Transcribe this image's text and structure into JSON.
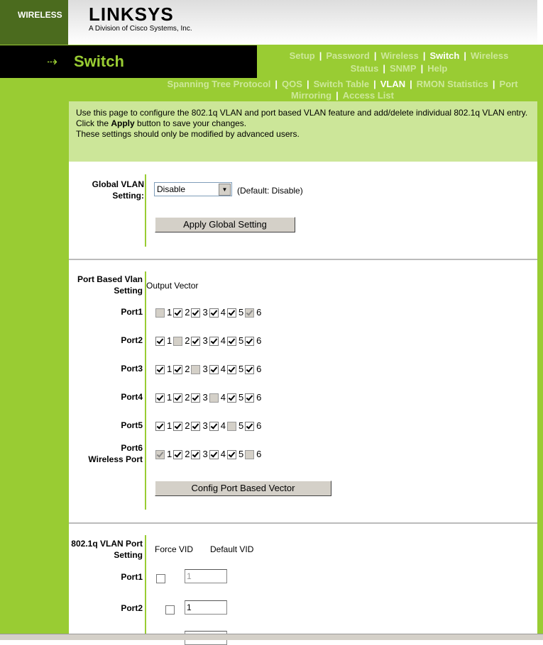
{
  "header": {
    "brand": "WIRELESS",
    "logo": "LINKSYS",
    "logo_sub": "A Division of Cisco Systems, Inc.",
    "section": "Switch",
    "accent": "#99cc33"
  },
  "nav_main": [
    {
      "label": "Setup"
    },
    {
      "label": "Password"
    },
    {
      "label": "Wireless"
    },
    {
      "label": "Switch",
      "selected": true
    },
    {
      "label": "Wireless Status"
    },
    {
      "label": "SNMP"
    },
    {
      "label": "Help"
    }
  ],
  "nav_sub": [
    {
      "label": "Spanning Tree Protocol"
    },
    {
      "label": "QOS"
    },
    {
      "label": "Switch Table"
    },
    {
      "label": "VLAN",
      "selected": true
    },
    {
      "label": "RMON Statistics"
    },
    {
      "label": "Port Mirroring"
    },
    {
      "label": "Access List"
    }
  ],
  "info": {
    "line1": "Use this page to configure the 802.1q VLAN and port based VLAN feature and add/delete individual 802.1q VLAN entry.",
    "line2a": "Click the ",
    "line2b": "Apply",
    "line2c": " button to save your changes.",
    "line3": "These settings should only be modified by advanced users."
  },
  "global": {
    "label": "Global VLAN Setting:",
    "value": "Disable",
    "default": "(Default: Disable)",
    "apply": "Apply Global Setting"
  },
  "port_based": {
    "label": "Port Based Vlan Setting",
    "header": "Output Vector",
    "button": "Config Port Based Vector",
    "ports": [
      {
        "label": "Port1",
        "states": [
          "dis",
          "on",
          "on",
          "on",
          "on",
          "dison"
        ]
      },
      {
        "label": "Port2",
        "states": [
          "on",
          "dis",
          "on",
          "on",
          "on",
          "on"
        ]
      },
      {
        "label": "Port3",
        "states": [
          "on",
          "on",
          "dis",
          "on",
          "on",
          "on"
        ]
      },
      {
        "label": "Port4",
        "states": [
          "on",
          "on",
          "on",
          "dis",
          "on",
          "on"
        ]
      },
      {
        "label": "Port5",
        "states": [
          "on",
          "on",
          "on",
          "on",
          "dis",
          "on"
        ]
      },
      {
        "label": "Port6",
        "sublabel": "Wireless Port",
        "states": [
          "dison",
          "on",
          "on",
          "on",
          "on",
          "dis"
        ]
      }
    ],
    "columns": [
      "1",
      "2",
      "3",
      "4",
      "5",
      "6"
    ]
  },
  "dot1q": {
    "label": "802.1q VLAN Port Setting",
    "force_vid": "Force VID",
    "default_vid": "Default VID",
    "ports": [
      {
        "label": "Port1",
        "force": false,
        "vid": "1",
        "disabled": true
      },
      {
        "label": "Port2",
        "force": false,
        "vid": "1",
        "disabled": false
      }
    ]
  }
}
